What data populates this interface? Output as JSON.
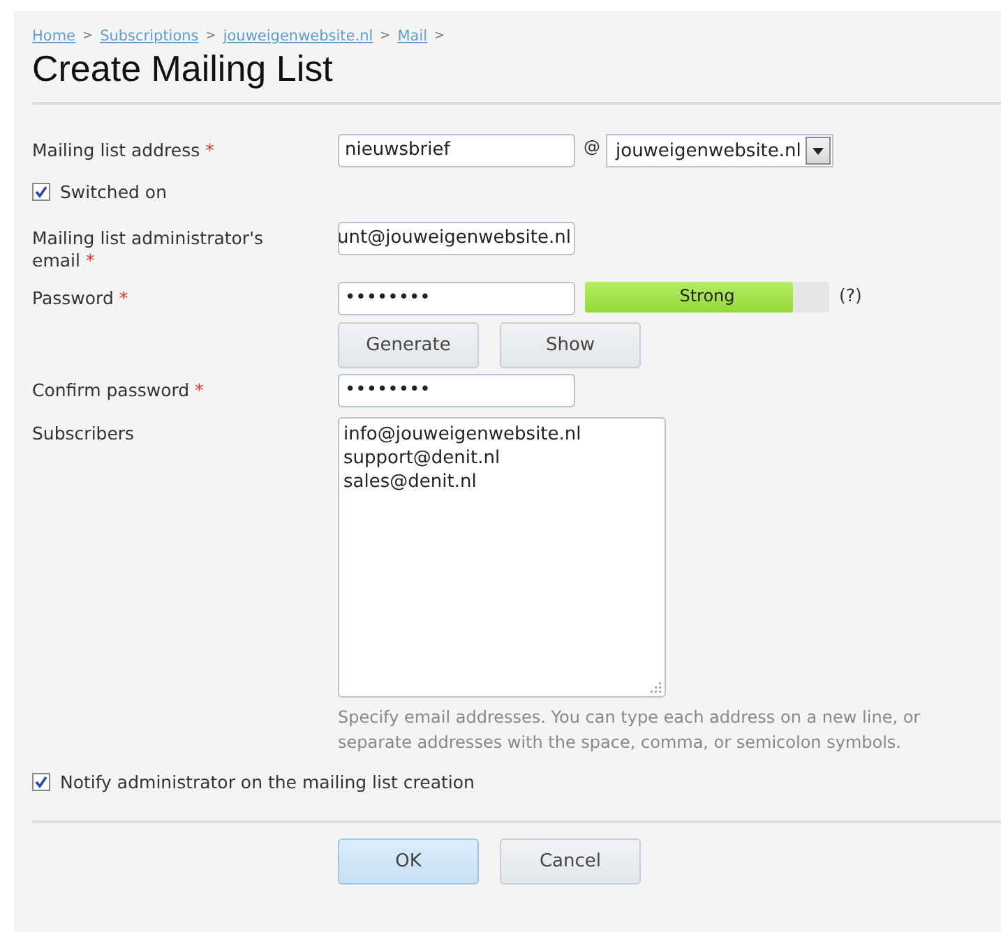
{
  "breadcrumbs": [
    "Home",
    "Subscriptions",
    "jouweigenwebsite.nl",
    "Mail"
  ],
  "breadcrumb_separator": ">",
  "title": "Create Mailing List",
  "address": {
    "label": "Mailing list address",
    "required": true,
    "value": "nieuwsbrief",
    "at": "@",
    "domain": "jouweigenwebsite.nl"
  },
  "switched_on": {
    "label": "Switched on",
    "checked": true
  },
  "admin_email": {
    "label": "Mailing list administrator's email",
    "required": true,
    "value": "unt@jouweigenwebsite.nl"
  },
  "password": {
    "label": "Password",
    "required": true,
    "value": "••••••••",
    "strength": "Strong",
    "level": 0.85,
    "help": "(?)",
    "buttons": [
      "Generate",
      "Show"
    ]
  },
  "confirm_password": {
    "label": "Confirm password",
    "required": true,
    "value": "••••••••"
  },
  "subscribers": {
    "label": "Subscribers",
    "lines": [
      "info@jouweigenwebsite.nl",
      "support@denit.nl",
      "sales@denit.nl"
    ],
    "hint": "Specify email addresses. You can type each address on a new line, or separate addresses with the space, comma, or semicolon symbols."
  },
  "notify": {
    "label": "Notify administrator on the mailing list creation",
    "checked": true
  },
  "buttons": [
    {
      "label": "OK",
      "kind": "primary"
    },
    {
      "label": "Cancel",
      "kind": "secondary"
    }
  ],
  "required_mark": "*"
}
